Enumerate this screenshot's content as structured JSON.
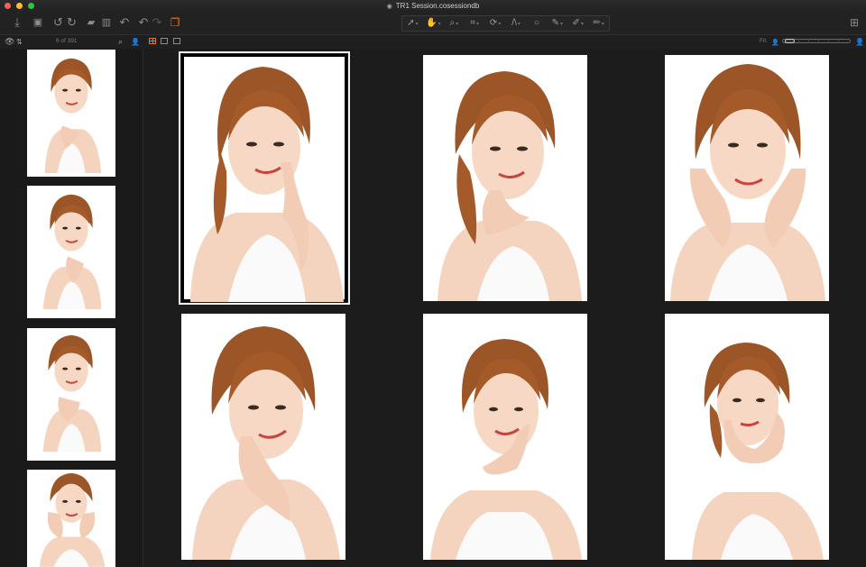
{
  "window": {
    "title": "TR1 Session.cosessiondb"
  },
  "toolbar": {
    "left_icons": [
      "import-icon",
      "camera-icon",
      "rotate-left-icon",
      "rotate-right-icon",
      "folder-move-icon",
      "trash-icon",
      "undo-icon",
      "undo-alt-icon",
      "redo-icon",
      "variants-icon"
    ],
    "cursor_tools": [
      "select-tool-icon",
      "pan-tool-icon",
      "loupe-tool-icon",
      "crop-tool-icon",
      "rotate-tool-icon",
      "keystone-tool-icon",
      "spot-tool-icon",
      "brush-tool-icon",
      "picker-tool-icon",
      "eraser-tool-icon"
    ],
    "right_icon": "viewer-layout-icon"
  },
  "browser": {
    "counter": "6 of 391"
  },
  "viewer": {
    "fit_label": "Fit",
    "zoom_fraction": 0.1
  },
  "colors": {
    "accent": "#e07b24",
    "background": "#1c1c1c",
    "hair": "#9c5527"
  }
}
